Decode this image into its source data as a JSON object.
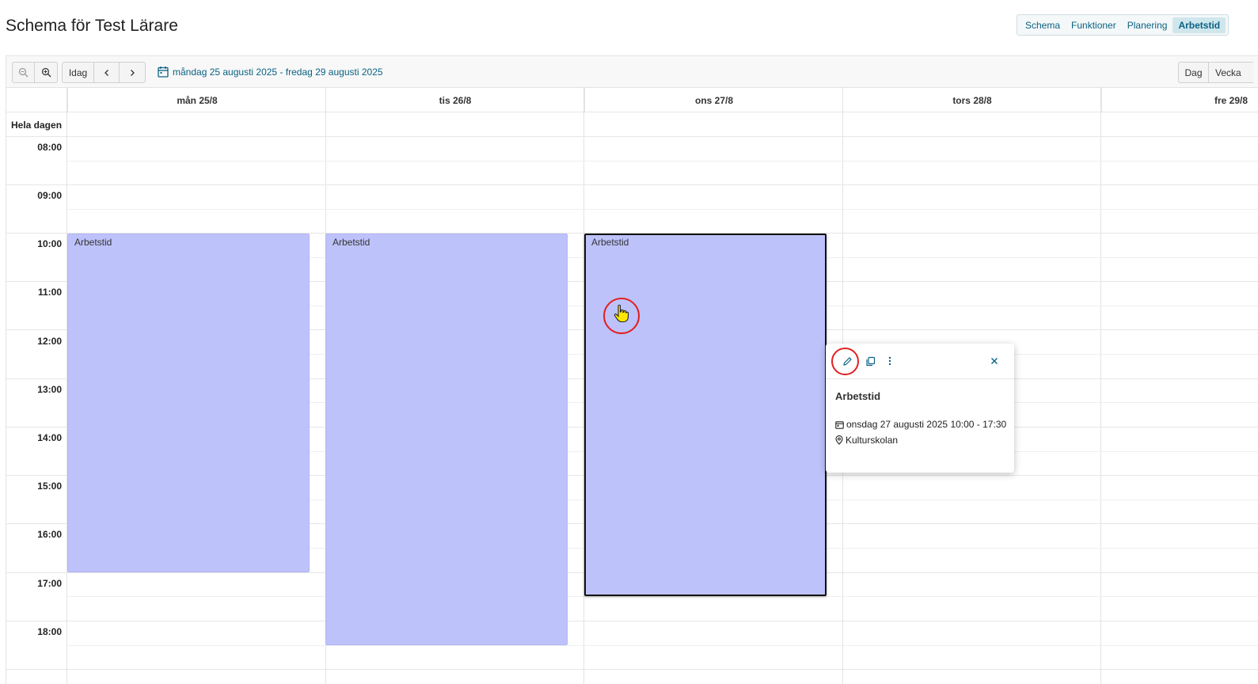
{
  "page_title": "Schema för Test Lärare",
  "topnav": {
    "items": [
      "Schema",
      "Funktioner",
      "Planering",
      "Arbetstid"
    ],
    "active": "Arbetstid"
  },
  "toolbar": {
    "zoom_out_icon": "zoom-out-icon",
    "zoom_in_icon": "zoom-in-icon",
    "today_label": "Idag",
    "prev_icon": "chevron-left-icon",
    "next_icon": "chevron-right-icon",
    "date_range": "måndag 25 augusti 2025 - fredag 29 augusti 2025",
    "view_day": "Dag",
    "view_week": "Vecka"
  },
  "calendar": {
    "all_day_label": "Hela dagen",
    "days": [
      "mån 25/8",
      "tis 26/8",
      "ons 27/8",
      "tors 28/8",
      "fre 29/8"
    ],
    "hours": [
      "08:00",
      "09:00",
      "10:00",
      "11:00",
      "12:00",
      "13:00",
      "14:00",
      "15:00",
      "16:00",
      "17:00",
      "18:00"
    ],
    "events": [
      {
        "title": "Arbetstid",
        "day": "mån 25/8",
        "start": "10:00",
        "end": "17:00"
      },
      {
        "title": "Arbetstid",
        "day": "tis 26/8",
        "start": "10:00",
        "end": "18:30"
      },
      {
        "title": "Arbetstid",
        "day": "ons 27/8",
        "start": "10:00",
        "end": "17:30",
        "selected": true
      }
    ],
    "event_color": "#bec2fb"
  },
  "popup": {
    "title": "Arbetstid",
    "datetime": "onsdag 27 augusti 2025 10:00 - 17:30",
    "location": "Kulturskolan",
    "icons": [
      "pencil-icon",
      "copy-icon",
      "more-vertical-icon",
      "close-icon"
    ]
  }
}
